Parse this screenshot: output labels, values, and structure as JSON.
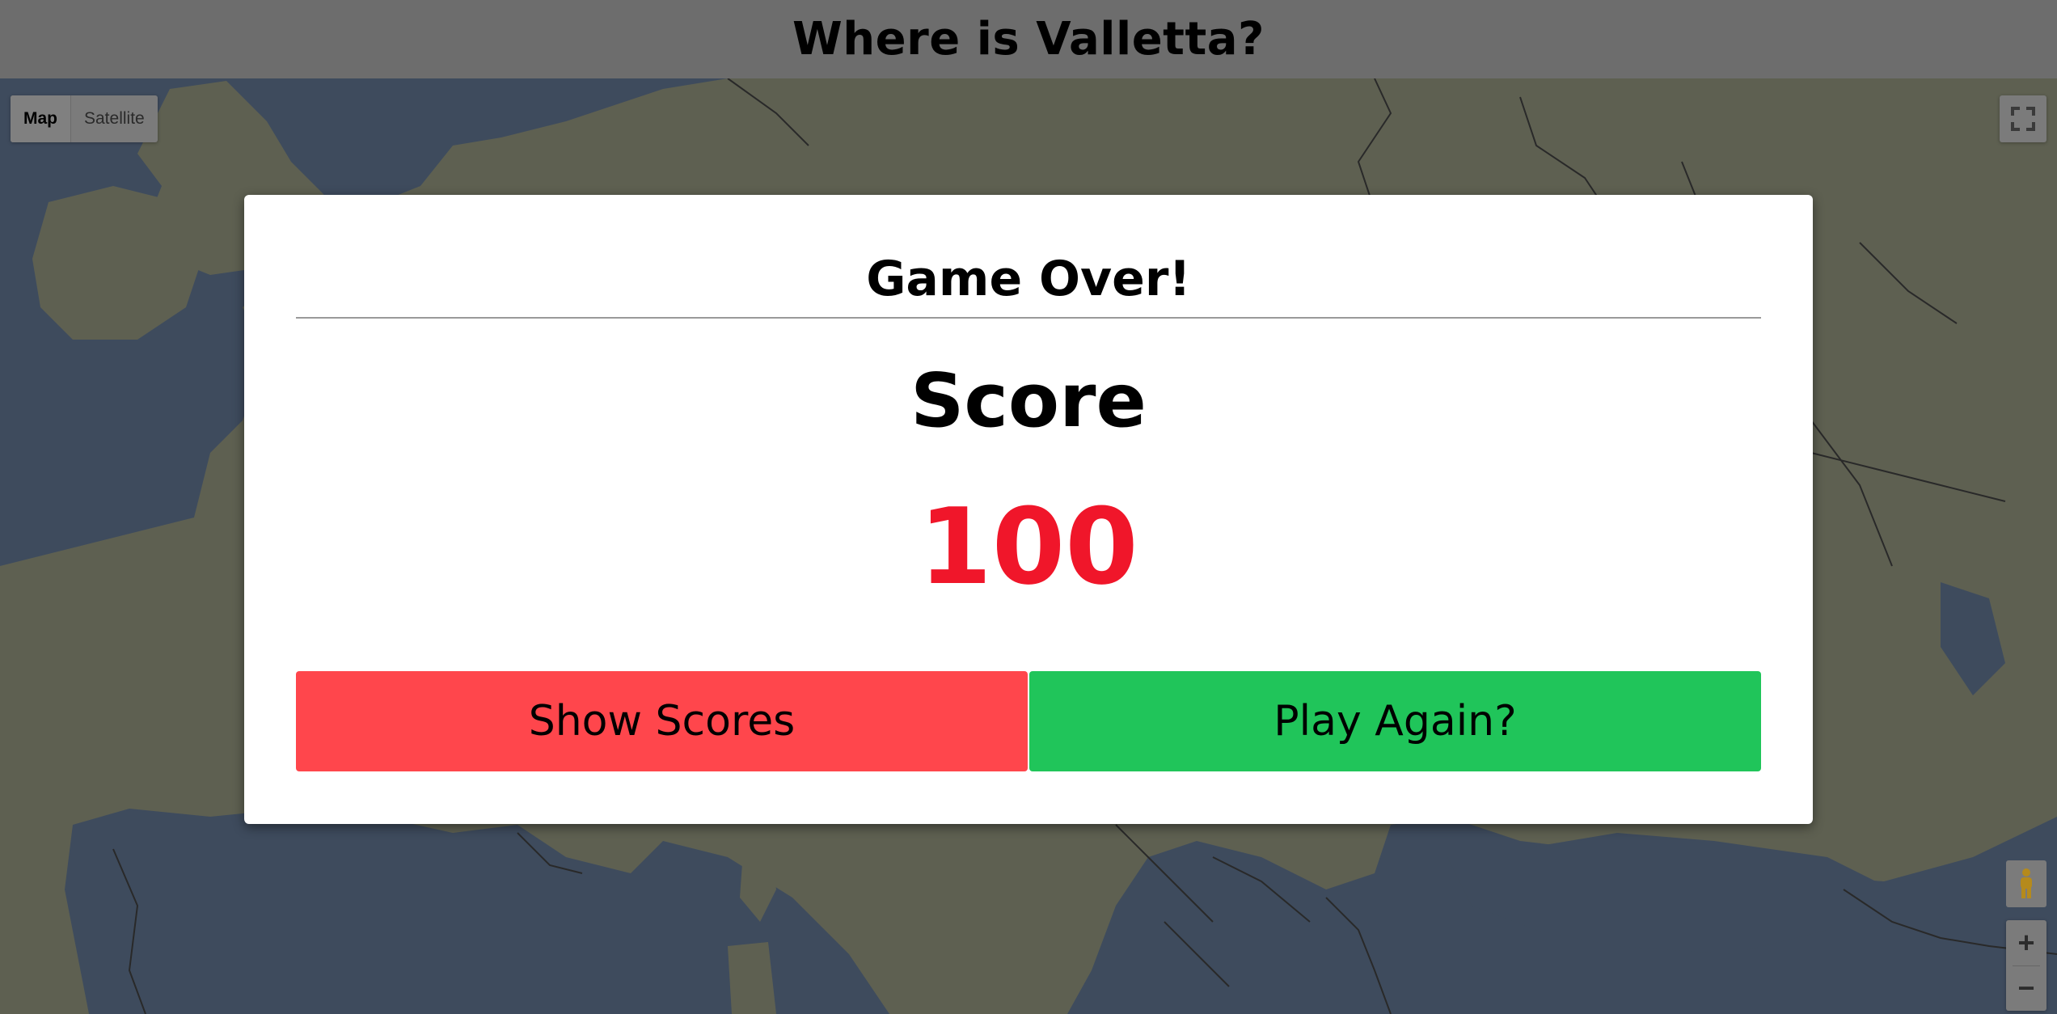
{
  "header": {
    "title": "Where is Valletta?"
  },
  "map_controls": {
    "map_label": "Map",
    "satellite_label": "Satellite",
    "zoom_in_label": "+",
    "zoom_out_label": "−",
    "fullscreen_icon": "fullscreen-icon",
    "pegman_icon": "pegman-icon"
  },
  "modal": {
    "title": "Game Over!",
    "score_label": "Score",
    "score_value": "100",
    "show_scores_label": "Show Scores",
    "play_again_label": "Play Again?"
  },
  "colors": {
    "score_value": "#f0162a",
    "show_scores_button": "#ff464c",
    "play_again_button": "#20c55a",
    "topbar": "#6d6d6d",
    "water": "#4a5f7a",
    "land": "#7c7f68"
  }
}
